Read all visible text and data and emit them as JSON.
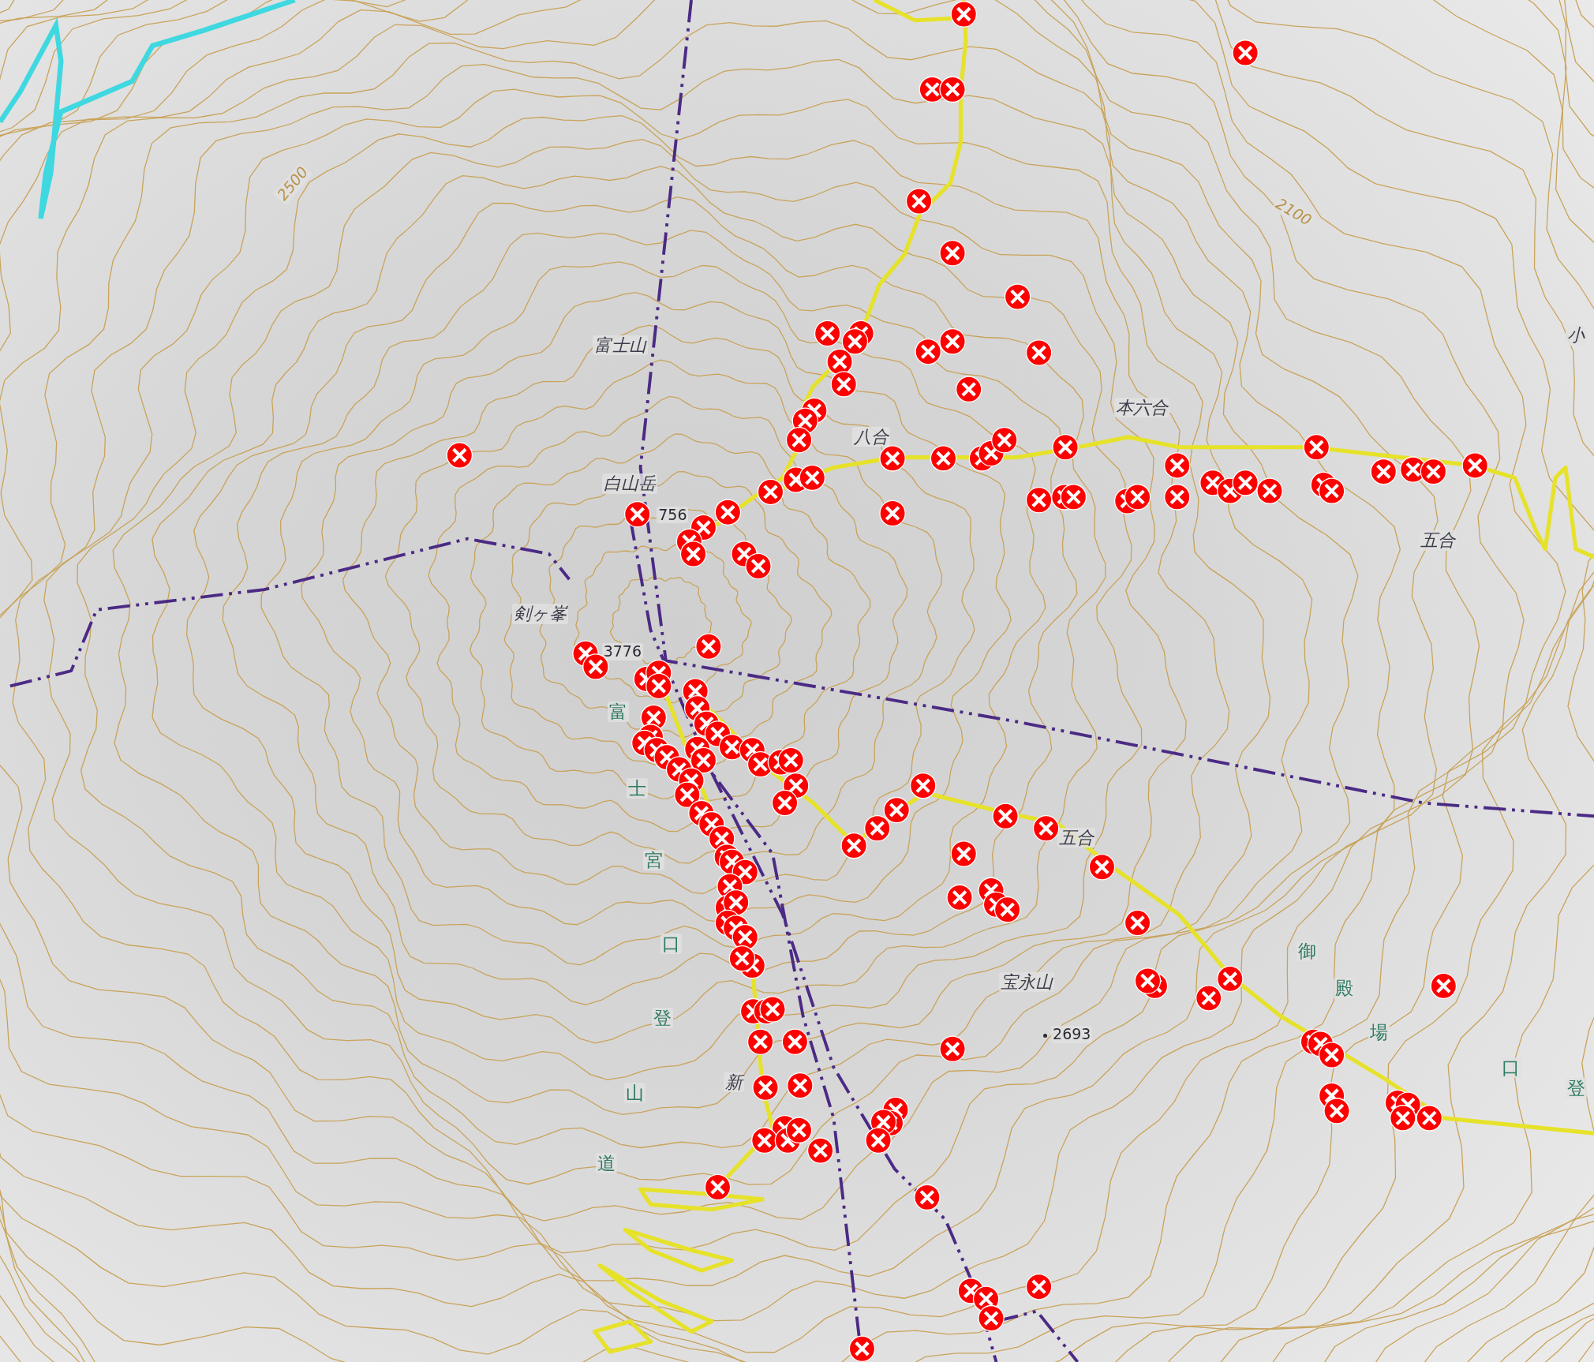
{
  "map": {
    "place_labels": [
      {
        "text": "富士山"
      },
      {
        "text": "白山岳"
      },
      {
        "text": "剣ヶ峯"
      },
      {
        "text": "八合"
      },
      {
        "text": "本六合"
      },
      {
        "text": "五合"
      },
      {
        "text": "五合"
      },
      {
        "text": "宝永山"
      },
      {
        "text": "新"
      },
      {
        "text": "小"
      }
    ],
    "elevation_labels": [
      {
        "text": "756",
        "kind": "plain"
      },
      {
        "text": "3776",
        "kind": "plain"
      },
      {
        "text": "2693",
        "kind": "spot"
      }
    ],
    "contour_labels": [
      {
        "text": "2500"
      },
      {
        "text": "2100"
      }
    ],
    "trail_labels": [
      {
        "chars": [
          "富",
          "士",
          "宮",
          "口",
          "登",
          "山",
          "道"
        ]
      },
      {
        "chars": [
          "御",
          "殿",
          "場",
          "口",
          "登"
        ]
      }
    ]
  }
}
